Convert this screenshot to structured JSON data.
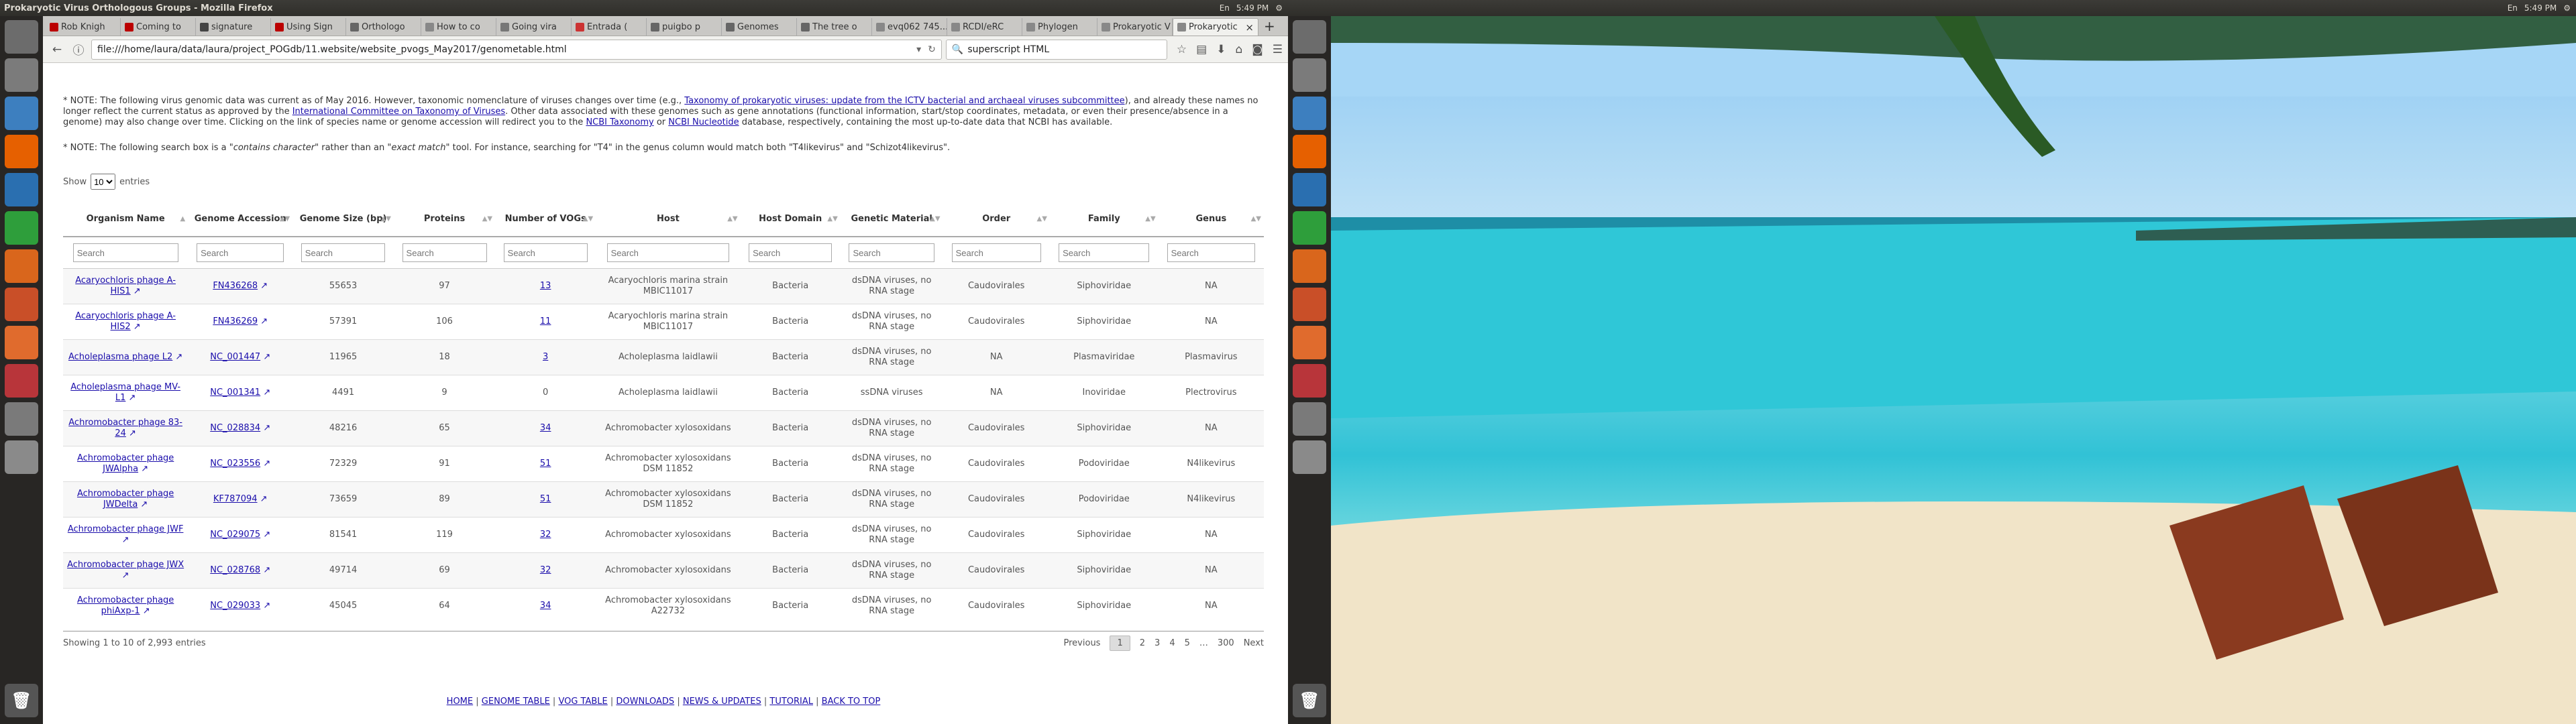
{
  "title_bar": "Prokaryotic Virus Orthologous Groups - Mozilla Firefox",
  "tray": {
    "kb": "En",
    "time": "5:49 PM"
  },
  "tabs": [
    {
      "label": "Rob Knigh",
      "color": "#b00"
    },
    {
      "label": "Coming to",
      "color": "#b00"
    },
    {
      "label": "signature",
      "color": "#444"
    },
    {
      "label": "Using Sign",
      "color": "#b00"
    },
    {
      "label": "Orthologo",
      "color": "#666"
    },
    {
      "label": "How to co",
      "color": "#888"
    },
    {
      "label": "Going vira",
      "color": "#777"
    },
    {
      "label": "Entrada (",
      "color": "#c33"
    },
    {
      "label": "puigbo p",
      "color": "#666"
    },
    {
      "label": "Genomes",
      "color": "#666"
    },
    {
      "label": "The tree o",
      "color": "#666"
    },
    {
      "label": "evq062 745...",
      "color": "#888"
    },
    {
      "label": "RCDI/eRC",
      "color": "#888"
    },
    {
      "label": "Phylogen",
      "color": "#888"
    },
    {
      "label": "Prokaryotic V",
      "color": "#888"
    },
    {
      "label": "Prokaryotic",
      "color": "#888"
    }
  ],
  "url": "file:///home/laura/data/laura/project_POGdb/11.website/website_pvogs_May2017/genometable.html",
  "search_box": "superscript HTML",
  "note1": {
    "a": "* NOTE: The following virus genomic data was current as of May 2016. However, taxonomic nomenclature of viruses changes over time (e.g., ",
    "l1": "Taxonomy of prokaryotic viruses: update from the ICTV bacterial and archaeal viruses subcommittee",
    "b": "), and already these names no longer reflect the current status as approved by the ",
    "l2": "International Committee on Taxonomy of Viruses",
    "c": ". Other data associated with these genomes such as gene annotations (functional information, start/stop coordinates, metadata, or even their presence/absence in a genome) may also change over time. Clicking on the link of species name or genome accession will redirect you to the ",
    "l3": "NCBI Taxonomy",
    "d": " or ",
    "l4": "NCBI Nucleotide",
    "e": " database, respectively, containing the most up-to-date data that NCBI has available."
  },
  "note2": {
    "a": "* NOTE: The following search box is a ",
    "i1": "\"contains character\"",
    "b": " rather than an ",
    "i2": "\"exact match\"",
    "c": " tool. For instance, searching for \"T4\" in the genus column would match both \"T4likevirus\" and \"Schizot4likevirus\"."
  },
  "len": {
    "show": "Show",
    "value": "10",
    "entries": "entries"
  },
  "headers": [
    "Organism Name",
    "Genome Accession",
    "Genome Size (bp)",
    "Proteins",
    "Number of VOGs",
    "Host",
    "Host Domain",
    "Genetic Material",
    "Order",
    "Family",
    "Genus"
  ],
  "search_placeholder": "Search",
  "rows": [
    [
      "Acaryochloris phage A-HIS1",
      "FN436268",
      "55653",
      "97",
      "13",
      "Acaryochloris marina strain MBIC11017",
      "Bacteria",
      "dsDNA viruses, no RNA stage",
      "Caudovirales",
      "Siphoviridae",
      "NA"
    ],
    [
      "Acaryochloris phage A-HIS2",
      "FN436269",
      "57391",
      "106",
      "11",
      "Acaryochloris marina strain MBIC11017",
      "Bacteria",
      "dsDNA viruses, no RNA stage",
      "Caudovirales",
      "Siphoviridae",
      "NA"
    ],
    [
      "Acholeplasma phage L2",
      "NC_001447",
      "11965",
      "18",
      "3",
      "Acholeplasma laidlawii",
      "Bacteria",
      "dsDNA viruses, no RNA stage",
      "NA",
      "Plasmaviridae",
      "Plasmavirus"
    ],
    [
      "Acholeplasma phage MV-L1",
      "NC_001341",
      "4491",
      "9",
      "0",
      "Acholeplasma laidlawii",
      "Bacteria",
      "ssDNA viruses",
      "NA",
      "Inoviridae",
      "Plectrovirus"
    ],
    [
      "Achromobacter phage 83-24",
      "NC_028834",
      "48216",
      "65",
      "34",
      "Achromobacter xylosoxidans",
      "Bacteria",
      "dsDNA viruses, no RNA stage",
      "Caudovirales",
      "Siphoviridae",
      "NA"
    ],
    [
      "Achromobacter phage JWAlpha",
      "NC_023556",
      "72329",
      "91",
      "51",
      "Achromobacter xylosoxidans DSM 11852",
      "Bacteria",
      "dsDNA viruses, no RNA stage",
      "Caudovirales",
      "Podoviridae",
      "N4likevirus"
    ],
    [
      "Achromobacter phage JWDelta",
      "KF787094",
      "73659",
      "89",
      "51",
      "Achromobacter xylosoxidans DSM 11852",
      "Bacteria",
      "dsDNA viruses, no RNA stage",
      "Caudovirales",
      "Podoviridae",
      "N4likevirus"
    ],
    [
      "Achromobacter phage JWF",
      "NC_029075",
      "81541",
      "119",
      "32",
      "Achromobacter xylosoxidans",
      "Bacteria",
      "dsDNA viruses, no RNA stage",
      "Caudovirales",
      "Siphoviridae",
      "NA"
    ],
    [
      "Achromobacter phage JWX",
      "NC_028768",
      "49714",
      "69",
      "32",
      "Achromobacter xylosoxidans",
      "Bacteria",
      "dsDNA viruses, no RNA stage",
      "Caudovirales",
      "Siphoviridae",
      "NA"
    ],
    [
      "Achromobacter phage phiAxp-1",
      "NC_029033",
      "45045",
      "64",
      "34",
      "Achromobacter xylosoxidans A22732",
      "Bacteria",
      "dsDNA viruses, no RNA stage",
      "Caudovirales",
      "Siphoviridae",
      "NA"
    ]
  ],
  "info": "Showing 1 to 10 of 2,993 entries",
  "pager": {
    "prev": "Previous",
    "pages": [
      "1",
      "2",
      "3",
      "4",
      "5"
    ],
    "ellipsis": "…",
    "last": "300",
    "next": "Next"
  },
  "footer_links": [
    "HOME",
    "GENOME TABLE",
    "VOG TABLE",
    "DOWNLOADS",
    "NEWS & UPDATES",
    "TUTORIAL",
    "BACK TO TOP"
  ],
  "launcher_colors": [
    "#6c6c6c",
    "#7b7b7b",
    "#3d7fbf",
    "#e66000",
    "#2a6fb0",
    "#2e9e3b",
    "#d9661c",
    "#c94f28",
    "#e06b2d",
    "#b8353a",
    "#7a7a7a",
    "#8a8a8a"
  ]
}
